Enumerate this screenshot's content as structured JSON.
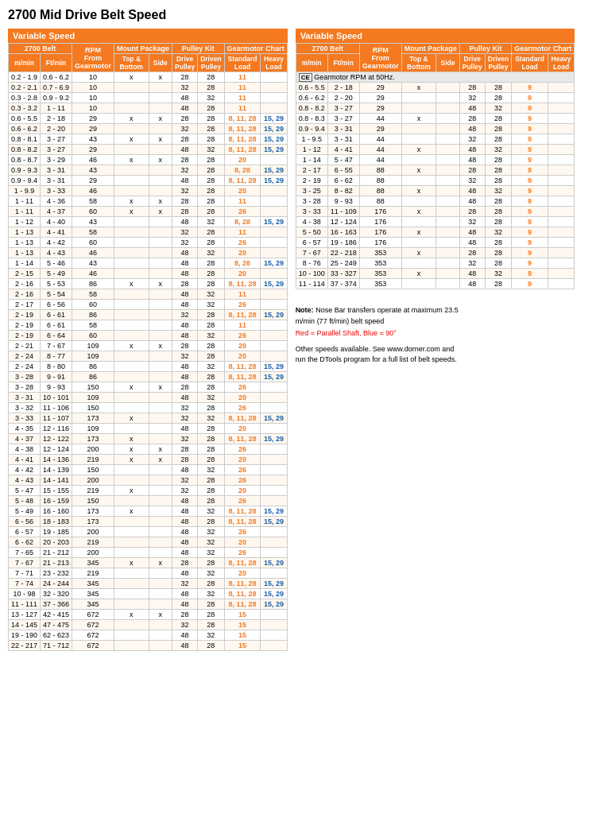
{
  "title": "2700 Mid Drive Belt Speed",
  "leftSection": {
    "header": "Variable Speed",
    "colHeaders": {
      "belt2700": "2700 Belt",
      "rpm": "RPM From Gearmotor",
      "mountPackage": "Mount Package",
      "pulleyKit": "Pulley Kit",
      "gearmotorChart": "Gearmotor Chart"
    },
    "subHeaders": [
      "m/min",
      "Ft/min",
      "",
      "Top & Bottom",
      "Side",
      "Drive Pulley",
      "Driven Pulley",
      "Standard Load",
      "Heavy Load"
    ],
    "rows": [
      [
        "0.2 - 1.9",
        "0.6 - 6.2",
        "10",
        "x",
        "x",
        "28",
        "28",
        "11",
        ""
      ],
      [
        "0.2 - 2.1",
        "0.7 - 6.9",
        "10",
        "",
        "",
        "32",
        "28",
        "11",
        ""
      ],
      [
        "0.3 - 2.8",
        "0.9 - 9.2",
        "10",
        "",
        "",
        "48",
        "32",
        "11",
        ""
      ],
      [
        "0.3 - 3.2",
        "1 - 11",
        "10",
        "",
        "",
        "48",
        "28",
        "11",
        ""
      ],
      [
        "0.6 - 5.5",
        "2 - 18",
        "29",
        "x",
        "x",
        "28",
        "28",
        "8, 11, 28",
        "15, 29"
      ],
      [
        "0.6 - 6.2",
        "2 - 20",
        "29",
        "",
        "",
        "32",
        "28",
        "8, 11, 28",
        "15, 29"
      ],
      [
        "0.8 - 8.1",
        "3 - 27",
        "43",
        "x",
        "x",
        "28",
        "28",
        "8, 11, 28",
        "15, 29"
      ],
      [
        "0.8 - 8.2",
        "3 - 27",
        "29",
        "",
        "",
        "48",
        "32",
        "8, 11, 28",
        "15, 29"
      ],
      [
        "0.8 - 8.7",
        "3 - 29",
        "46",
        "x",
        "x",
        "28",
        "28",
        "20",
        ""
      ],
      [
        "0.9 - 9.3",
        "3 - 31",
        "43",
        "",
        "",
        "32",
        "28",
        "8, 28",
        "15, 29"
      ],
      [
        "0.9 - 9.4",
        "3 - 31",
        "29",
        "",
        "",
        "48",
        "28",
        "8, 11, 28",
        "15, 29"
      ],
      [
        "1 - 9.9",
        "3 - 33",
        "46",
        "",
        "",
        "32",
        "28",
        "20",
        ""
      ],
      [
        "1 - 11",
        "4 - 36",
        "58",
        "x",
        "x",
        "28",
        "28",
        "11",
        ""
      ],
      [
        "1 - 11",
        "4 - 37",
        "60",
        "x",
        "x",
        "28",
        "28",
        "26",
        ""
      ],
      [
        "1 - 12",
        "4 - 40",
        "43",
        "",
        "",
        "48",
        "32",
        "8, 28",
        "15, 29"
      ],
      [
        "1 - 13",
        "4 - 41",
        "58",
        "",
        "",
        "32",
        "28",
        "11",
        ""
      ],
      [
        "1 - 13",
        "4 - 42",
        "60",
        "",
        "",
        "32",
        "28",
        "26",
        ""
      ],
      [
        "1 - 13",
        "4 - 43",
        "46",
        "",
        "",
        "48",
        "32",
        "20",
        ""
      ],
      [
        "1 - 14",
        "5 - 46",
        "43",
        "",
        "",
        "48",
        "28",
        "8, 28",
        "15, 29"
      ],
      [
        "2 - 15",
        "5 - 49",
        "46",
        "",
        "",
        "48",
        "28",
        "20",
        ""
      ],
      [
        "2 - 16",
        "5 - 53",
        "86",
        "x",
        "x",
        "28",
        "28",
        "8, 11, 28",
        "15, 29"
      ],
      [
        "2 - 16",
        "5 - 54",
        "58",
        "",
        "",
        "48",
        "32",
        "11",
        ""
      ],
      [
        "2 - 17",
        "6 - 56",
        "60",
        "",
        "",
        "48",
        "32",
        "26",
        ""
      ],
      [
        "2 - 19",
        "6 - 61",
        "86",
        "",
        "",
        "32",
        "28",
        "8, 11, 28",
        "15, 29"
      ],
      [
        "2 - 19",
        "6 - 61",
        "58",
        "",
        "",
        "48",
        "28",
        "11",
        ""
      ],
      [
        "2 - 19",
        "6 - 64",
        "60",
        "",
        "",
        "48",
        "32",
        "26",
        ""
      ],
      [
        "2 - 21",
        "7 - 67",
        "109",
        "x",
        "x",
        "28",
        "28",
        "20",
        ""
      ],
      [
        "2 - 24",
        "8 - 77",
        "109",
        "",
        "",
        "32",
        "28",
        "20",
        ""
      ],
      [
        "2 - 24",
        "8 - 80",
        "86",
        "",
        "",
        "48",
        "32",
        "8, 11, 28",
        "15, 29"
      ],
      [
        "3 - 28",
        "9 - 91",
        "86",
        "",
        "",
        "48",
        "28",
        "8, 11, 28",
        "15, 29"
      ],
      [
        "3 - 28",
        "9 - 93",
        "150",
        "x",
        "x",
        "28",
        "28",
        "26",
        ""
      ],
      [
        "3 - 31",
        "10 - 101",
        "109",
        "",
        "",
        "48",
        "32",
        "20",
        ""
      ],
      [
        "3 - 32",
        "11 - 106",
        "150",
        "",
        "",
        "32",
        "28",
        "26",
        ""
      ],
      [
        "3 - 33",
        "11 - 107",
        "173",
        "x",
        "",
        "32",
        "32",
        "8, 11, 28",
        "15, 29"
      ],
      [
        "4 - 35",
        "12 - 116",
        "109",
        "",
        "",
        "48",
        "28",
        "20",
        ""
      ],
      [
        "4 - 37",
        "12 - 122",
        "173",
        "x",
        "",
        "32",
        "28",
        "8, 11, 28",
        "15, 29"
      ],
      [
        "4 - 38",
        "12 - 124",
        "200",
        "x",
        "x",
        "28",
        "28",
        "26",
        ""
      ],
      [
        "4 - 41",
        "14 - 136",
        "219",
        "x",
        "x",
        "28",
        "28",
        "20",
        ""
      ],
      [
        "4 - 42",
        "14 - 139",
        "150",
        "",
        "",
        "48",
        "32",
        "26",
        ""
      ],
      [
        "4 - 43",
        "14 - 141",
        "200",
        "",
        "",
        "32",
        "28",
        "26",
        ""
      ],
      [
        "5 - 47",
        "15 - 155",
        "219",
        "x",
        "",
        "32",
        "28",
        "20",
        ""
      ],
      [
        "5 - 48",
        "16 - 159",
        "150",
        "",
        "",
        "48",
        "28",
        "26",
        ""
      ],
      [
        "5 - 49",
        "16 - 160",
        "173",
        "x",
        "",
        "48",
        "32",
        "8, 11, 28",
        "15, 29"
      ],
      [
        "6 - 56",
        "18 - 183",
        "173",
        "",
        "",
        "48",
        "28",
        "8, 11, 28",
        "15, 29"
      ],
      [
        "6 - 57",
        "19 - 185",
        "200",
        "",
        "",
        "48",
        "32",
        "26",
        ""
      ],
      [
        "6 - 62",
        "20 - 203",
        "219",
        "",
        "",
        "48",
        "32",
        "20",
        ""
      ],
      [
        "7 - 65",
        "21 - 212",
        "200",
        "",
        "",
        "48",
        "32",
        "26",
        ""
      ],
      [
        "7 - 67",
        "21 - 213",
        "345",
        "x",
        "x",
        "28",
        "28",
        "8, 11, 28",
        "15, 29"
      ],
      [
        "7 - 71",
        "23 - 232",
        "219",
        "",
        "",
        "48",
        "32",
        "20",
        ""
      ],
      [
        "7 - 74",
        "24 - 244",
        "345",
        "",
        "",
        "32",
        "28",
        "8, 11, 28",
        "15, 29"
      ],
      [
        "10 - 98",
        "32 - 320",
        "345",
        "",
        "",
        "48",
        "32",
        "8, 11, 28",
        "15, 29"
      ],
      [
        "11 - 111",
        "37 - 366",
        "345",
        "",
        "",
        "48",
        "28",
        "8, 11, 28",
        "15, 29"
      ],
      [
        "13 - 127",
        "42 - 415",
        "672",
        "x",
        "x",
        "28",
        "28",
        "15",
        ""
      ],
      [
        "14 - 145",
        "47 - 475",
        "672",
        "",
        "",
        "32",
        "28",
        "15",
        ""
      ],
      [
        "19 - 190",
        "62 - 623",
        "672",
        "",
        "",
        "48",
        "32",
        "15",
        ""
      ],
      [
        "22 - 217",
        "71 - 712",
        "672",
        "",
        "",
        "48",
        "28",
        "15",
        ""
      ]
    ]
  },
  "rightSection": {
    "header": "Variable Speed",
    "colHeaders": {
      "belt2700": "2700 Belt",
      "rpm": "RPM From Gearmotor",
      "mountPackage": "Mount Package",
      "pulleyKit": "Pulley Kit",
      "gearmotorChart": "Gearmotor Chart"
    },
    "subHeaders": [
      "m/min",
      "Ft/min",
      "",
      "Top & Bottom",
      "Side",
      "Drive Pulley",
      "Driven Pulley",
      "Standard Load",
      "Heavy Load"
    ],
    "ceNote": "Gearmotor RPM at 50Hz.",
    "rows": [
      [
        "0.6 - 5.5",
        "2 - 18",
        "29",
        "x",
        "",
        "28",
        "28",
        "9",
        ""
      ],
      [
        "0.6 - 6.2",
        "2 - 20",
        "29",
        "",
        "",
        "32",
        "28",
        "9",
        ""
      ],
      [
        "0.8 - 8.2",
        "3 - 27",
        "29",
        "",
        "",
        "48",
        "32",
        "9",
        ""
      ],
      [
        "0.8 - 8.3",
        "3 - 27",
        "44",
        "x",
        "",
        "28",
        "28",
        "9",
        ""
      ],
      [
        "0.9 - 9.4",
        "3 - 31",
        "29",
        "",
        "",
        "48",
        "28",
        "9",
        ""
      ],
      [
        "1 - 9.5",
        "3 - 31",
        "44",
        "",
        "",
        "32",
        "28",
        "9",
        ""
      ],
      [
        "1 - 12",
        "4 - 41",
        "44",
        "x",
        "",
        "48",
        "32",
        "9",
        ""
      ],
      [
        "1 - 14",
        "5 - 47",
        "44",
        "",
        "",
        "48",
        "28",
        "9",
        ""
      ],
      [
        "2 - 17",
        "6 - 55",
        "88",
        "x",
        "",
        "28",
        "28",
        "9",
        ""
      ],
      [
        "2 - 19",
        "6 - 62",
        "88",
        "",
        "",
        "32",
        "28",
        "9",
        ""
      ],
      [
        "3 - 25",
        "8 - 82",
        "88",
        "x",
        "",
        "48",
        "32",
        "9",
        ""
      ],
      [
        "3 - 28",
        "9 - 93",
        "88",
        "",
        "",
        "48",
        "28",
        "9",
        ""
      ],
      [
        "3 - 33",
        "11 - 109",
        "176",
        "x",
        "",
        "28",
        "28",
        "9",
        ""
      ],
      [
        "4 - 38",
        "12 - 124",
        "176",
        "",
        "",
        "32",
        "28",
        "9",
        ""
      ],
      [
        "5 - 50",
        "16 - 163",
        "176",
        "x",
        "",
        "48",
        "32",
        "9",
        ""
      ],
      [
        "6 - 57",
        "19 - 186",
        "176",
        "",
        "",
        "48",
        "28",
        "9",
        ""
      ],
      [
        "7 - 67",
        "22 - 218",
        "353",
        "x",
        "",
        "28",
        "28",
        "9",
        ""
      ],
      [
        "8 - 76",
        "25 - 249",
        "353",
        "",
        "",
        "32",
        "28",
        "9",
        ""
      ],
      [
        "10 - 100",
        "33 - 327",
        "353",
        "x",
        "",
        "48",
        "32",
        "9",
        ""
      ],
      [
        "11 - 114",
        "37 - 374",
        "353",
        "",
        "",
        "48",
        "28",
        "9",
        ""
      ]
    ]
  },
  "notes": {
    "label": "Note:",
    "text1": " Nose Bar transfers operate at maximum 23.5 m/min (77 ft/min) belt speed",
    "text2": "Red = Parallel Shaft, Blue = 90°",
    "text3": "Other speeds available. See www.dorner.com and run the DTools program for a full list of belt speeds."
  }
}
